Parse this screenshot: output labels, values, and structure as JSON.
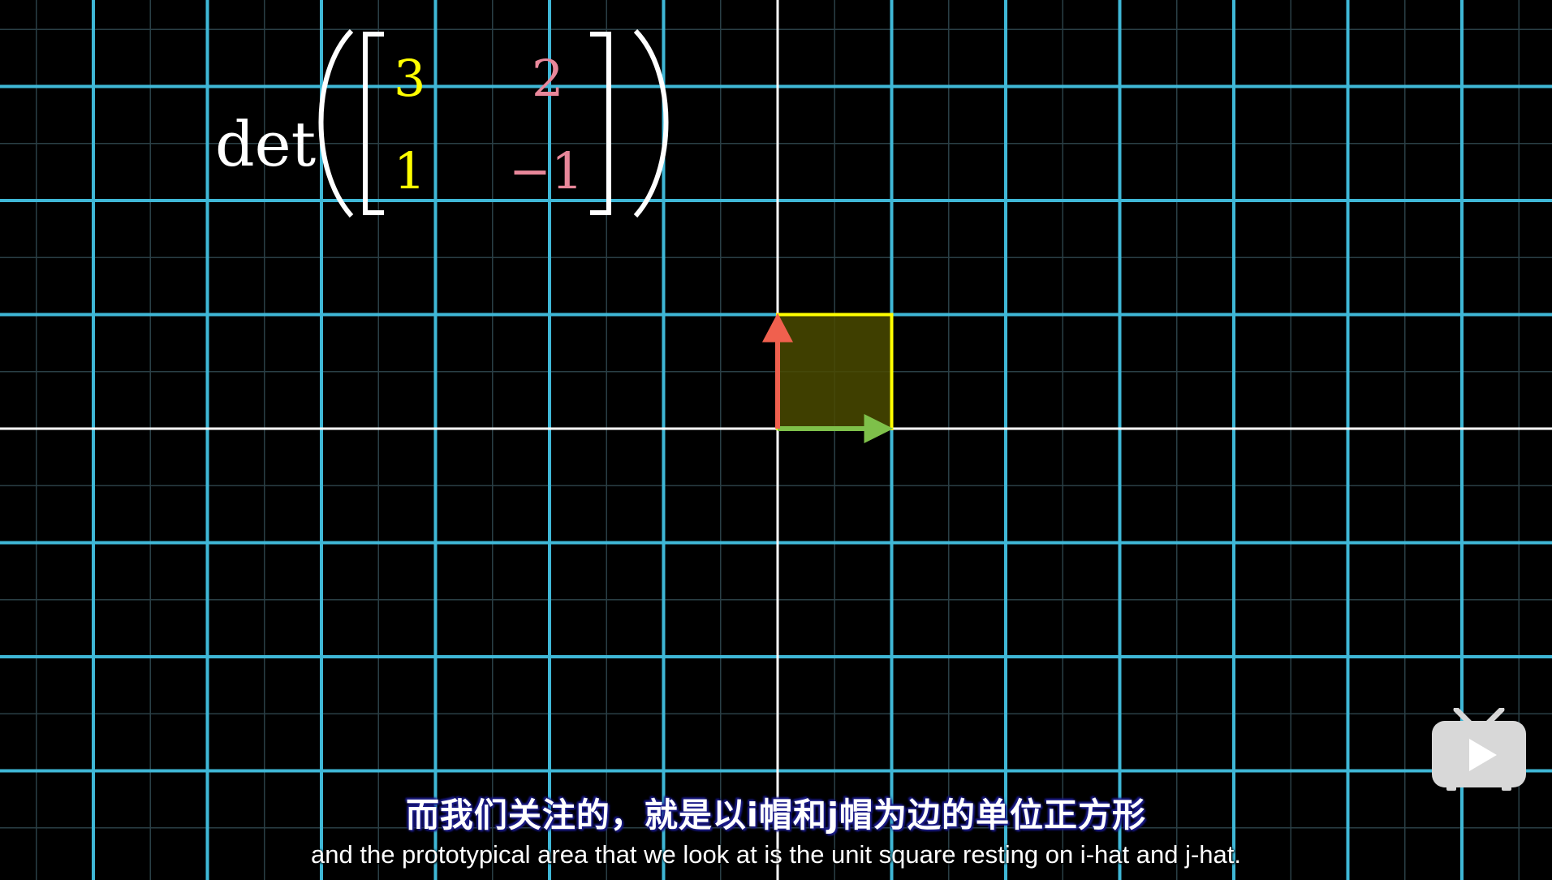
{
  "formula": {
    "function": "det",
    "matrix": [
      [
        "3",
        "2"
      ],
      [
        "1",
        "−1"
      ]
    ],
    "column_colors": [
      "#ffff00",
      "#e8879a"
    ]
  },
  "plane": {
    "grid_color": "#3fb7d6",
    "minor_grid_color": "#2a3f46",
    "axis_color": "#ffffff",
    "i_hat_color": "#7ec04a",
    "j_hat_color": "#f0604e",
    "unit_square_stroke": "#ffff00",
    "unit_square_fill": "#4a4a00"
  },
  "subtitles": {
    "chinese": "而我们关注的，就是以i帽和j帽为边的单位正方形",
    "english": "and the prototypical area that we look at is the unit square resting on i-hat and j-hat."
  },
  "watermark": {
    "icon": "tv-play-icon",
    "color": "#d8d8d8"
  }
}
